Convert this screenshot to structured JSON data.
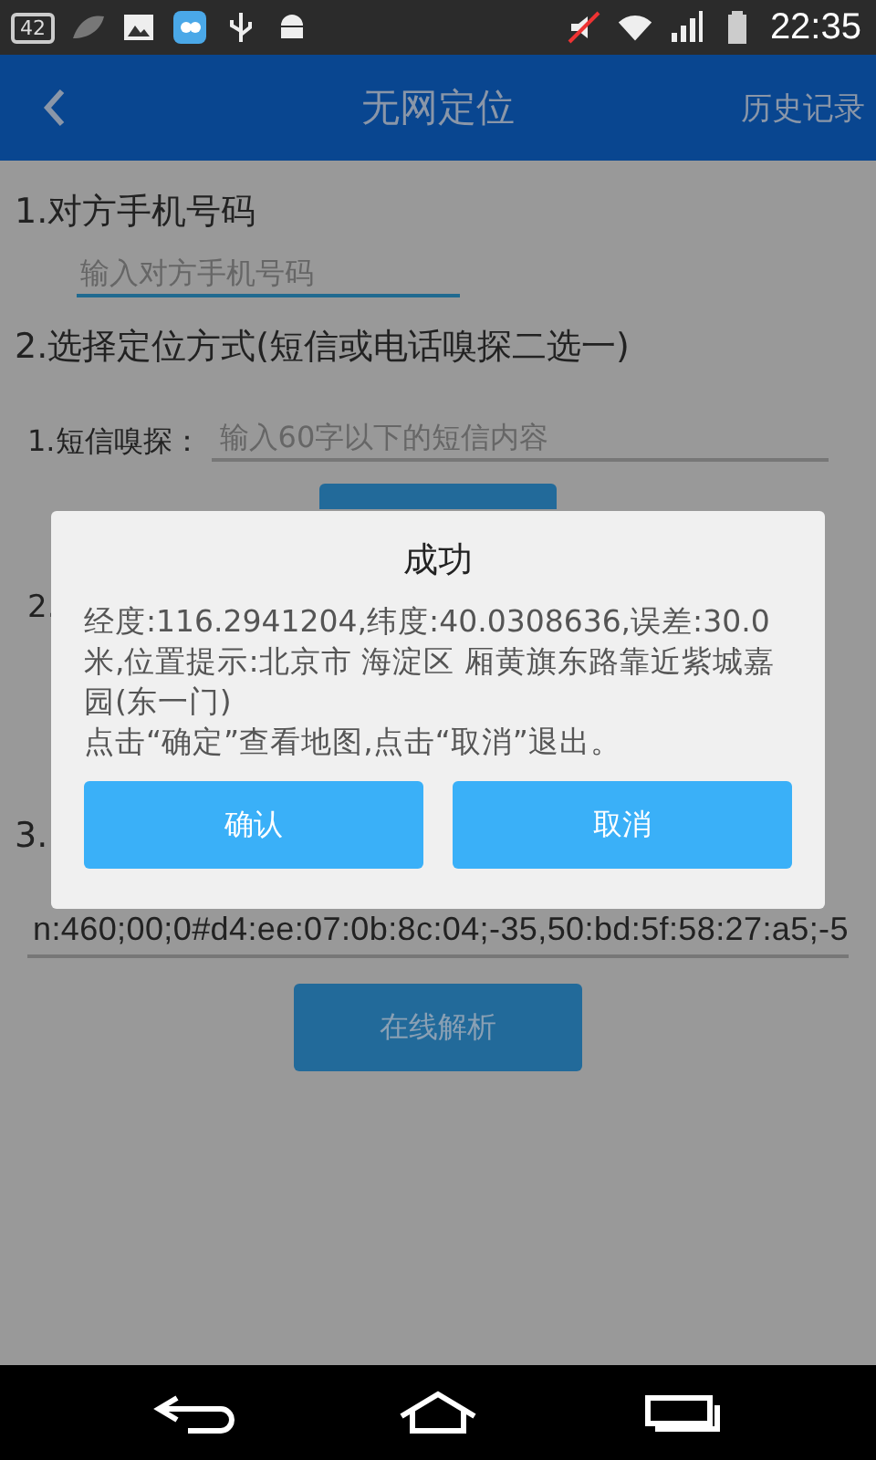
{
  "status_bar": {
    "badge": "42",
    "time": "22:35"
  },
  "app_bar": {
    "title": "无网定位",
    "action": "历史记录"
  },
  "form": {
    "phone_label": "1.对方手机号码",
    "phone_placeholder": "输入对方手机号码",
    "method_label": "2.选择定位方式(短信或电话嗅探二选一)",
    "sms_label": "1.短信嗅探：",
    "sms_placeholder": "输入60字以下的短信内容",
    "second_option_label": "2.",
    "third_section_label": "3.",
    "data_value": "n:460;00;0#d4:ee:07:0b:8c:04;-35,50:bd:5f:58:27:a5;-5",
    "parse_button": "在线解析"
  },
  "dialog": {
    "title": "成功",
    "message": "经度:116.2941204,纬度:40.0308636,误差:30.0米,位置提示:北京市 海淀区 厢黄旗东路靠近紫城嘉园(东一门)\n点击“确定”查看地图,点击“取消”退出。",
    "buttons": [
      "确认",
      "取消"
    ]
  }
}
